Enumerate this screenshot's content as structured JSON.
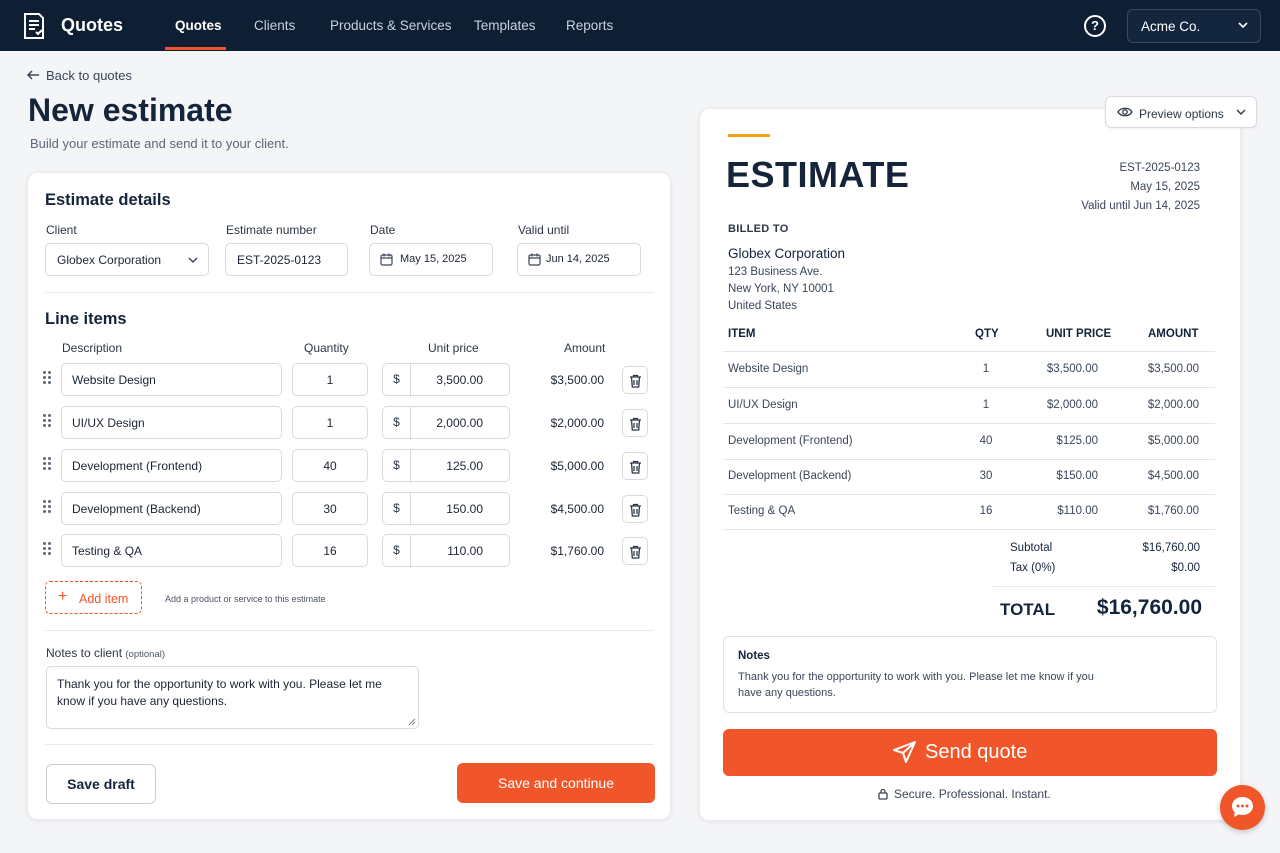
{
  "app": {
    "title": "Quotes",
    "logo_icon": "quote-document-icon"
  },
  "nav": {
    "items": [
      {
        "label": "Quotes",
        "active": true
      },
      {
        "label": "Clients"
      },
      {
        "label": "Products & Services"
      },
      {
        "label": "Templates"
      },
      {
        "label": "Reports"
      }
    ],
    "help_glyph": "?",
    "account": "Acme Co."
  },
  "header": {
    "back": "Back to quotes",
    "title": "New estimate",
    "subtitle": "Build your estimate and send it to your client."
  },
  "form": {
    "details_title": "Estimate details",
    "client_label": "Client",
    "client_value": "Globex Corporation",
    "number_label": "Estimate number",
    "number_value": "EST-2025-0123",
    "date_label": "Date",
    "date_value": "May 15, 2025",
    "valid_label": "Valid until",
    "valid_value": "Jun 14, 2025",
    "line_items_title": "Line items",
    "columns": {
      "description": "Description",
      "quantity": "Quantity",
      "unit_price": "Unit price",
      "amount": "Amount"
    },
    "currency_symbol": "$",
    "items": [
      {
        "description": "Website Design",
        "quantity": "1",
        "unit_price": "3,500.00",
        "amount": "$3,500.00"
      },
      {
        "description": "UI/UX Design",
        "quantity": "1",
        "unit_price": "2,000.00",
        "amount": "$2,000.00"
      },
      {
        "description": "Development (Frontend)",
        "quantity": "40",
        "unit_price": "125.00",
        "amount": "$5,000.00"
      },
      {
        "description": "Development (Backend)",
        "quantity": "30",
        "unit_price": "150.00",
        "amount": "$4,500.00"
      },
      {
        "description": "Testing & QA",
        "quantity": "16",
        "unit_price": "110.00",
        "amount": "$1,760.00"
      }
    ],
    "add_item": "Add item",
    "add_hint": "Add a product or service to this estimate",
    "notes_label": "Notes to client",
    "notes_optional": "(optional)",
    "notes_value": "Thank you for the opportunity to work with you. Please let me know if you have any questions.",
    "save_draft": "Save draft",
    "save_continue": "Save and continue"
  },
  "preview": {
    "options_label": "Preview options",
    "doc_title": "ESTIMATE",
    "number": "EST-2025-0123",
    "date": "May 15, 2025",
    "valid": "Valid until Jun 14, 2025",
    "billed_to_label": "BILLED TO",
    "billed_name": "Globex Corporation",
    "address": [
      "123 Business Ave.",
      "New York, NY 10001",
      "United States"
    ],
    "columns": {
      "item": "ITEM",
      "qty": "QTY",
      "unit_price": "UNIT PRICE",
      "amount": "AMOUNT"
    },
    "items": [
      {
        "item": "Website Design",
        "qty": "1",
        "unit_price": "$3,500.00",
        "amount": "$3,500.00"
      },
      {
        "item": "UI/UX Design",
        "qty": "1",
        "unit_price": "$2,000.00",
        "amount": "$2,000.00"
      },
      {
        "item": "Development (Frontend)",
        "qty": "40",
        "unit_price": "$125.00",
        "amount": "$5,000.00"
      },
      {
        "item": "Development (Backend)",
        "qty": "30",
        "unit_price": "$150.00",
        "amount": "$4,500.00"
      },
      {
        "item": "Testing & QA",
        "qty": "16",
        "unit_price": "$110.00",
        "amount": "$1,760.00"
      }
    ],
    "subtotal_label": "Subtotal",
    "subtotal": "$16,760.00",
    "tax_label": "Tax (0%)",
    "tax": "$0.00",
    "total_label": "TOTAL",
    "total": "$16,760.00",
    "notes_title": "Notes",
    "notes_text": "Thank you for the opportunity to work with you. Please let me know if you have any questions.",
    "send_label": "Send quote",
    "secure_text": "Secure. Professional. Instant."
  },
  "colors": {
    "navy": "#0f1f33",
    "accent": "#f0562a",
    "gold": "#f2a11b"
  }
}
